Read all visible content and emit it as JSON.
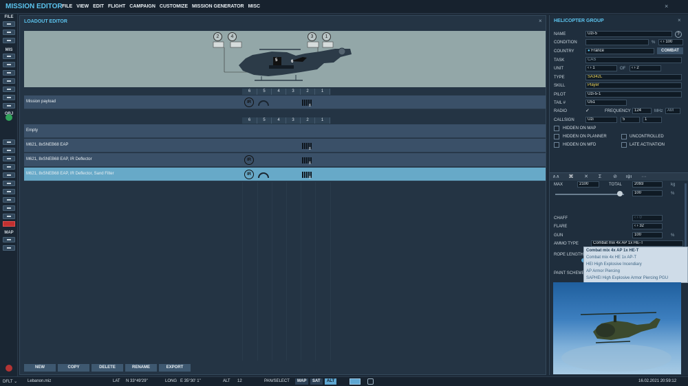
{
  "app": {
    "title": "MISSION EDITOR",
    "menu": [
      "FILE",
      "VIEW",
      "EDIT",
      "FLIGHT",
      "CAMPAIGN",
      "CUSTOMIZE",
      "MISSION GENERATOR",
      "MISC"
    ],
    "close_glyph": "×"
  },
  "toolbar": {
    "sections": [
      "FILE",
      "MIS",
      "OBJ",
      "MAP"
    ]
  },
  "loadout": {
    "title": "LOADOUT EDITOR",
    "close_glyph": "×",
    "heli_labels": {
      "b2": "2",
      "b4": "4",
      "b3": "3",
      "b1": "1",
      "p5": "5",
      "p6": "6"
    },
    "slots": [
      "6",
      "5",
      "4",
      "3",
      "2",
      "1"
    ],
    "mission_payload": {
      "label": "Mission payload",
      "ir": "IR",
      "pod_count": "8"
    },
    "rows": [
      {
        "label": "Empty"
      },
      {
        "label": "M621, 8xSNEB68 EAP",
        "pod_count": "8"
      },
      {
        "label": "M621, 8xSNEB68 EAP, IR Deflector",
        "ir": "IR",
        "pod_count": "8"
      },
      {
        "label": "M621, 8xSNEB68 EAP, IR Deflector, Sand Filter",
        "ir": "IR",
        "pod_count": "8"
      }
    ],
    "buttons": [
      "NEW",
      "COPY",
      "DELETE",
      "RENAME",
      "EXPORT"
    ]
  },
  "group": {
    "title": "HELICOPTER GROUP",
    "close_glyph": "×",
    "help": "?",
    "name_label": "NAME",
    "name": "Uzi-5",
    "condition_label": "CONDITION",
    "condition_unit": "%",
    "condition_value": "100",
    "country_label": "COUNTRY",
    "country": "France",
    "combat_label": "COMBAT",
    "task_label": "TASK",
    "task": "CAS",
    "unit_label": "UNIT",
    "unit_value": "1",
    "of_label": "OF",
    "unit_total": "2",
    "type_label": "TYPE",
    "type": "SA342L",
    "skill_label": "SKILL",
    "skill": "Player",
    "pilot_label": "PILOT",
    "pilot": "Uzi-5-1",
    "tail_label": "TAIL #",
    "tail": "U51",
    "radio_label": "RADIO",
    "radio_check": "✓",
    "frequency_label": "FREQUENCY",
    "frequency": "124",
    "mhz": "MHz",
    "am": "AM",
    "callsign_label": "CALLSIGN",
    "callsign": "Uzi",
    "callsign_n1": "5",
    "callsign_n2": "1",
    "checkboxes": [
      "HIDDEN ON MAP",
      "HIDDEN ON PLANNER",
      "UNCONTROLLED",
      "HIDDEN ON MFD",
      "LATE ACTIVATION"
    ]
  },
  "payload": {
    "tabs": [
      "∧∧",
      "⌘",
      "✕",
      "Σ",
      "⊘",
      "ıψı",
      "···"
    ],
    "max_label": "MAX",
    "max": "2100",
    "total_label": "TOTAL",
    "total": "2093",
    "kg": "kg",
    "fuel_percent": "100",
    "fuel_percent_value": 100,
    "pct": "%",
    "chaff_label": "CHAFF",
    "chaff": "0",
    "flare_label": "FLARE",
    "flare": "32",
    "gun_label": "GUN",
    "gun": "100",
    "ammo_label": "AMMO TYPE",
    "ammo": "Combat mix 4x AP 1x HE-T",
    "rope_label": "ROPE LENGTH",
    "paint_label": "PAINT SCHEME",
    "ammo_options": [
      "Combat mix 4x AP 1x HE-T",
      "Combat mix 4x HE 1x AP-T",
      "HEI High Explosive Incendiary",
      "AP Armor Piercing",
      "SAPHEI High Explosive Armor Piercing PGU"
    ]
  },
  "status": {
    "mode": "DFLT",
    "file": "Lebanon.miz",
    "lat_label": "LAT",
    "lat": "N 33°49'29\"",
    "long_label": "LONG",
    "long": "E 35°30' 1\"",
    "alt_label": "ALT",
    "alt": "12",
    "pan_select": "PAN/SELECT",
    "map_btn": "MAP",
    "sat_btn": "SAT",
    "alt_btn": "ALT",
    "datetime": "16.02.2021 20:59:12"
  },
  "colors": {
    "accent": "#5cc4ee",
    "selected_row": "#67a9c8",
    "callout": "#f1d85a"
  }
}
